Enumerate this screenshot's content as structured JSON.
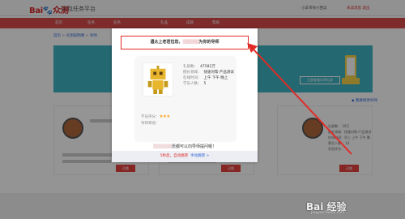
{
  "header": {
    "logo_text": "Bai",
    "logo_suffix": "众测",
    "site_title": "众包任务平台",
    "user_info": "小羊带你小西瓜",
    "user_links": "未读消息   退出"
  },
  "nav": {
    "items": [
      "首页",
      "任务",
      "任务",
      "礼品",
      "成就",
      "帮助"
    ]
  },
  "breadcrumb": {
    "home": "首页",
    "sep": ">",
    "section": "众测说明课",
    "current": "导师"
  },
  "banner": {
    "button_label": "立即查看导师礼屏",
    "right_link": "◆ 我要修改导师"
  },
  "cards": [
    {
      "button_label": "召唤"
    },
    {
      "button_label": "召唤"
    },
    {
      "button_label": "召唤"
    }
  ],
  "right_card": {
    "lines": [
      "礼屏数：    10万",
      "擅长领域：快速对帮·产品测试",
      "在线时间：早上 上午 下午 晚上",
      "学员人数：    14",
      "学员评分："
    ]
  },
  "modal": {
    "headline_left": "遇太上老君拉您，",
    "headline_blur": "▒▒▒▒▒▒",
    "headline_right": "为你的导师",
    "details": [
      {
        "label": "礼屏数：",
        "value": "47581万"
      },
      {
        "label": "擅长领域：",
        "value": "快速对帮·产品测试"
      },
      {
        "label": "在线时间：",
        "value": "上午  下午  晚上"
      },
      {
        "label": "学员人数：",
        "value": "5"
      }
    ],
    "score_label": "学员评分：",
    "stars": "★★★",
    "follow_label": "导师寄语：",
    "wish_blur": "▒▒▒▒▒▒",
    "wish_text": "愿都可以向导师提问喔！",
    "countdown": "5秒后，自动跳转",
    "close_link": "手动跳转 >"
  },
  "watermark": {
    "brand": "Bai 经验",
    "url": "jingyan.baidu.com"
  },
  "colors": {
    "brand_red": "#d7262b",
    "nav_red": "#d94a4a",
    "banner_teal": "#3fb3c3",
    "highlight_box": "#e02b27",
    "star": "#f6a623",
    "link_blue": "#2d64d8"
  }
}
